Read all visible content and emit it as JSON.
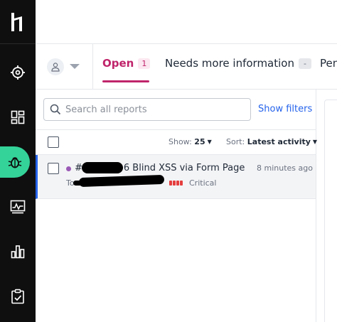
{
  "sidebar": {
    "logo": "h1",
    "items": [
      {
        "icon": "target-icon"
      },
      {
        "icon": "dashboard-icon"
      },
      {
        "icon": "bug-icon",
        "active": true
      },
      {
        "icon": "activity-icon"
      },
      {
        "icon": "bar-chart-icon"
      },
      {
        "icon": "clipboard-check-icon"
      }
    ],
    "active_color": "#34d399"
  },
  "tabs": {
    "open_label": "Open",
    "open_count": "1",
    "needs_info_label": "Needs more information",
    "needs_info_count": "-",
    "pending_label": "Pen"
  },
  "search": {
    "placeholder": "Search all reports",
    "show_filters_label": "Show filters"
  },
  "list_controls": {
    "show_label": "Show:",
    "show_value": "25",
    "sort_label": "Sort:",
    "sort_value": "Latest activity"
  },
  "reports": [
    {
      "title_prefix": "#",
      "title_suffix": "6 Blind XSS via Form Page",
      "time": "8 minutes ago",
      "meta_prefix": "To",
      "severity": "Critical",
      "state_color": "#9b59b6",
      "severity_color": "#e53e3e"
    }
  ],
  "colors": {
    "accent_pink": "#c0256b",
    "link_blue": "#2563eb"
  }
}
